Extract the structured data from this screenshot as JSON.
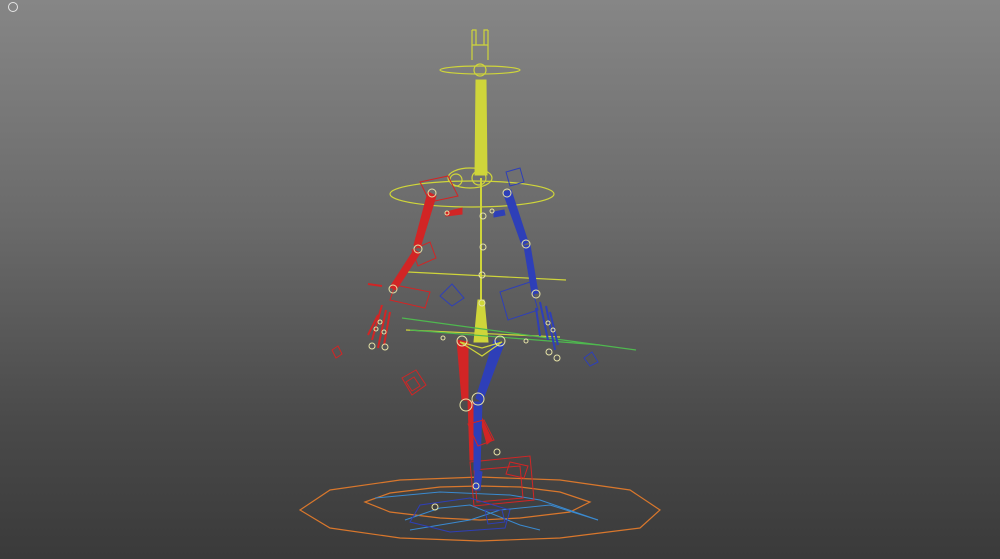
{
  "viewport": {
    "corner_icon": "circle-icon",
    "colors": {
      "background_top": "#868686",
      "background_bottom": "#3a3a3a",
      "spine": "#cfd53a",
      "left_side": "#d22525",
      "right_side": "#2e3fb8",
      "root_ground": "#d9772c",
      "pelvis_plane": "#4fb84f",
      "ground_lines": "#3a8ad0"
    }
  }
}
